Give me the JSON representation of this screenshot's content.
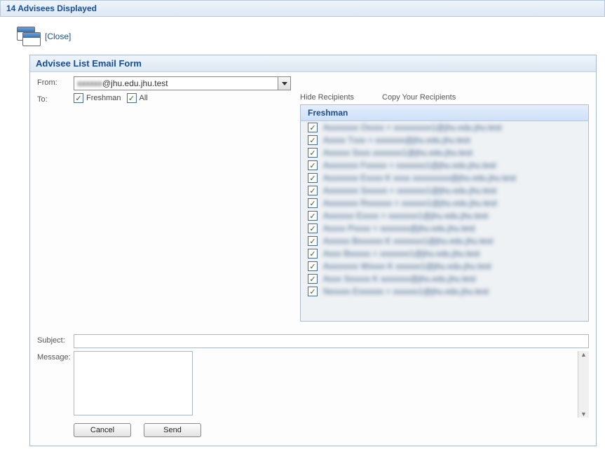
{
  "header": {
    "title": "14 Advisees Displayed"
  },
  "close_label": "[Close]",
  "form": {
    "title": "Advisee List Email Form",
    "from_label": "From:",
    "from_obscured": "xxxxxx",
    "from_domain": "@jhu.edu.jhu.test",
    "to_label": "To:",
    "to_options": [
      {
        "label": "Freshman",
        "checked": true
      },
      {
        "label": "All",
        "checked": true
      }
    ],
    "hide_recipients": "Hide Recipients",
    "copy_recipients": "Copy Your Recipients",
    "group_header": "Freshman",
    "recipients": [
      {
        "checked": true,
        "text": "Axxxxxxx Oxxxx = xxxxxxxxx1@jhu.edu.jhu.test"
      },
      {
        "checked": true,
        "text": "Axxxx Txxx = xxxxxxx@jhu.edu.jhu.test"
      },
      {
        "checked": true,
        "text": "Axxxxx Sxxx xxxxxxx1@jhu.edu.jhu.test"
      },
      {
        "checked": true,
        "text": "Axxxxxxx Fxxxxx = xxxxxxx1@jhu.edu.jhu.test"
      },
      {
        "checked": true,
        "text": "Axxxxxxx Exxxx K xxxx xxxxxxxxx@jhu.edu.jhu.test"
      },
      {
        "checked": true,
        "text": "Axxxxxxx Sxxxxx = xxxxxxx1@jhu.edu.jhu.test"
      },
      {
        "checked": true,
        "text": "Axxxxxxx Rxxxxxx = xxxxxx1@jhu.edu.jhu.test"
      },
      {
        "checked": true,
        "text": "Axxxxxx Exxxx = xxxxxxx1@jhu.edu.jhu.test"
      },
      {
        "checked": true,
        "text": "Axxxx Pxxxx = xxxxxxx@jhu.edu.jhu.test"
      },
      {
        "checked": true,
        "text": "Axxxxx Bxxxxxx K xxxxxxx1@jhu.edu.jhu.test"
      },
      {
        "checked": true,
        "text": "Axxx Bxxxxx = xxxxxxx1@jhu.edu.jhu.test"
      },
      {
        "checked": true,
        "text": "Axxxxxxx Wxxxx K xxxxxx1@jhu.edu.jhu.test"
      },
      {
        "checked": true,
        "text": "Axxx Sxxxxx K xxxxxxx@jhu.edu.jhu.test"
      },
      {
        "checked": true,
        "text": "Nxxxxx Exxxxxx = xxxxxx1@jhu.edu.jhu.test"
      }
    ],
    "subject_label": "Subject:",
    "subject_value": "",
    "message_label": "Message:",
    "message_value": "",
    "cancel_label": "Cancel",
    "send_label": "Send"
  }
}
